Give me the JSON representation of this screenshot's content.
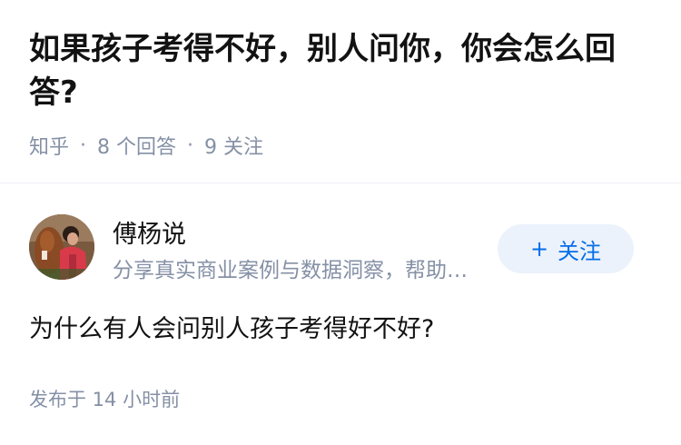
{
  "question": {
    "title": "如果孩子考得不好，别人问你，你会怎么回答?",
    "source": "知乎",
    "answer_count": "8 个回答",
    "follower_count": "9 关注"
  },
  "answer": {
    "author": {
      "name": "傅杨说",
      "bio": "分享真实商业案例与数据洞察，帮助更多人理解商业本质",
      "avatar_icon": "avatar-photo"
    },
    "follow_button": {
      "plus": "+",
      "label": "关注"
    },
    "content": "为什么有人会问别人孩子考得好不好?",
    "publish_time": "发布于 14 小时前"
  },
  "colors": {
    "title": "#121212",
    "meta": "#8590a6",
    "follow_bg": "#ebf2fb",
    "follow_text": "#056de8"
  }
}
